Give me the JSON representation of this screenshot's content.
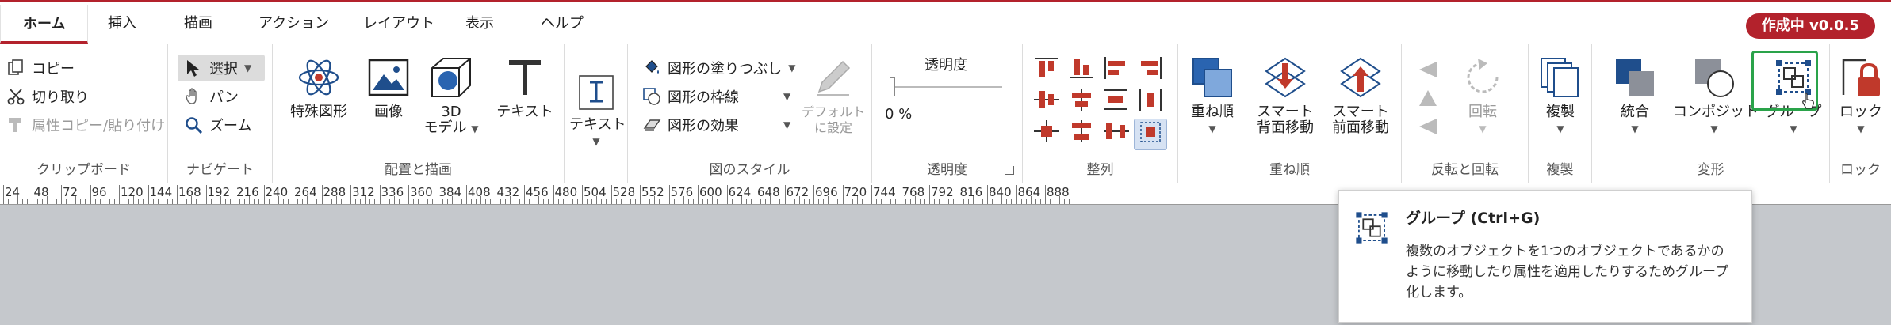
{
  "tabs": [
    "ホーム",
    "挿入",
    "描画",
    "アクション",
    "レイアウト",
    "表示",
    "ヘルプ"
  ],
  "status_badge": "作成中 v0.0.5",
  "clipboard": {
    "copy": "コピー",
    "cut": "切り取り",
    "format_painter": "属性コピー/貼り付け",
    "label": "クリップボード"
  },
  "navigate": {
    "select": "選択",
    "pan": "パン",
    "zoom": "ズーム",
    "label": "ナビゲート"
  },
  "place": {
    "special": "特殊図形",
    "image": "画像",
    "model3d_line1": "3D",
    "model3d_line2": "モデル",
    "text": "テキスト",
    "label": "配置と描画"
  },
  "text_group": {
    "text": "テキスト"
  },
  "shape_style": {
    "fill": "図形の塗りつぶし",
    "outline": "図形の枠線",
    "effect": "図形の効果",
    "default_line1": "デフォルト",
    "default_line2": "に設定",
    "label": "図のスタイル"
  },
  "transparency": {
    "title": "透明度",
    "value": "0 %",
    "label": "透明度"
  },
  "align": {
    "label": "整列"
  },
  "order": {
    "order": "重ね順",
    "smart_back_line1": "スマート",
    "smart_back_line2": "背面移動",
    "smart_front_line1": "スマート",
    "smart_front_line2": "前面移動",
    "label": "重ね順"
  },
  "flip": {
    "rotate": "回転",
    "label": "反転と回転"
  },
  "dup": {
    "duplicate": "複製",
    "label": "複製"
  },
  "transform": {
    "combine": "統合",
    "composite": "コンポジット",
    "group": "グループ",
    "label": "変形"
  },
  "lock": {
    "lock": "ロック",
    "label": "ロック"
  },
  "ruler": {
    "ticks": [
      "24",
      "48",
      "72",
      "96",
      "120",
      "144",
      "168",
      "192",
      "216",
      "240",
      "264",
      "288",
      "312",
      "336",
      "360",
      "384",
      "408",
      "432",
      "456",
      "480",
      "504",
      "528",
      "552",
      "576",
      "600",
      "624",
      "648",
      "672",
      "696",
      "720",
      "744",
      "768",
      "792",
      "816",
      "840",
      "864",
      "888"
    ]
  },
  "tooltip": {
    "title": "グループ (Ctrl+G)",
    "description": "複数のオブジェクトを1つのオブジェクトであるかのように移動したり属性を適用したりするためグループ化します。"
  },
  "colors": {
    "accent": "#b3222c",
    "highlight": "#2aa34a",
    "icon_blue": "#1f4e8c"
  }
}
